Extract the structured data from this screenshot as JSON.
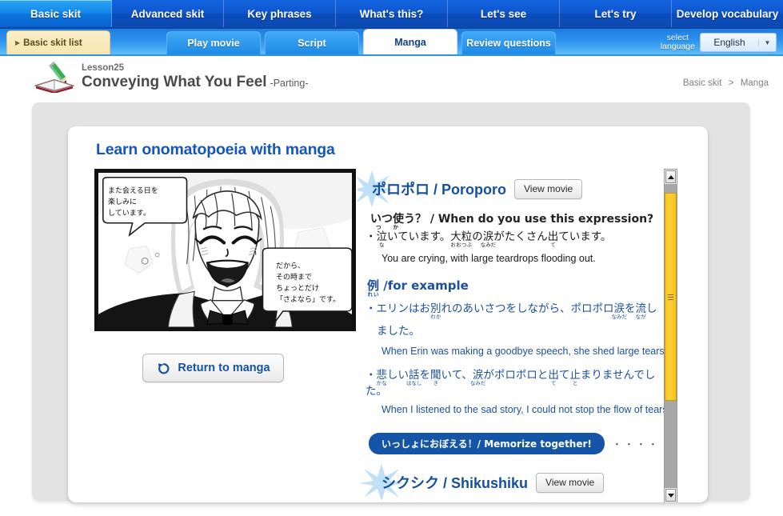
{
  "main_nav": {
    "items": [
      {
        "label": "Basic skit",
        "active": true
      },
      {
        "label": "Advanced skit",
        "active": false
      },
      {
        "label": "Key phrases",
        "active": false
      },
      {
        "label": "What's this?",
        "active": false
      },
      {
        "label": "Let's see",
        "active": false
      },
      {
        "label": "Let's try",
        "active": false
      },
      {
        "label": "Develop vocabulary",
        "active": false
      }
    ]
  },
  "sub_nav": {
    "skit_list_label": "Basic skit list",
    "tabs": [
      {
        "label": "Play movie",
        "active": false
      },
      {
        "label": "Script",
        "active": false
      },
      {
        "label": "Manga",
        "active": true
      },
      {
        "label": "Review questions",
        "active": false
      }
    ],
    "language_label_line1": "select",
    "language_label_line2": "language",
    "language_value": "English"
  },
  "lesson": {
    "number": "Lesson25",
    "title": "Conveying What You Feel",
    "subtitle": "-Parting-"
  },
  "breadcrumb": {
    "parent": "Basic skit",
    "separator": ">",
    "current": "Manga"
  },
  "panel": {
    "title": "Learn onomatopoeia with manga"
  },
  "manga": {
    "bubble_left": "また会える日を\n楽しみに\nしています。",
    "bubble_right": "だから、\nその時まで\nちょっとだけ\n「さよなら」です。",
    "return_button_label": "Return to manga",
    "return_icon": "undo-arrow-icon"
  },
  "entries": [
    {
      "title_jp": "ポロポロ",
      "title_sep": " / ",
      "title_romaji": "Poroporo",
      "view_movie_label": "View movie",
      "question_line": "いつ使う？ / When do you use this expression?",
      "question_ruby": "つか",
      "usage_jp_prefix": "・",
      "usage_jp": "泣いています。大粒の涙がたくさん出ています。",
      "usage_ruby": [
        "な",
        "おおつぶ",
        "なみだ",
        "て"
      ],
      "usage_en": "You are crying, with large teardrops flooding out.",
      "example_label": "例 /for example",
      "example_label_ruby": "れい",
      "examples": [
        {
          "jp": "・エリンはお別れのあいさつをしながら、ポロポロ涙を流しました。",
          "ruby": [
            "わか",
            "なみだ",
            "なが"
          ],
          "en": "When Erin was making a goodbye speech, she shed large tears."
        },
        {
          "jp": "・悲しい話を聞いて、涙がポロポロと出て止まりませんでした。",
          "ruby": [
            "かな",
            "はなし",
            "き",
            "なみだ",
            "て",
            "と"
          ],
          "en": "When I listened to the sad story, I could not stop the flow of tears."
        }
      ],
      "memorize_label": "いっしょにおぼえる！/ Memorize together!",
      "memorize_dots": "・・・・・・・・・・・・・・"
    },
    {
      "title_jp": "シクシク",
      "title_sep": " / ",
      "title_romaji": "Shikushiku",
      "view_movie_label": "View movie"
    }
  ],
  "scrollbar": {
    "up_icon": "chevron-up-icon",
    "down_icon": "chevron-down-icon",
    "thumb_color": "#f5c518"
  },
  "colors": {
    "nav_blue": "#0b55c4",
    "tab_blue": "#3fa9f5",
    "title_blue": "#1356bd",
    "entry_blue": "#15509d",
    "pill_blue": "#1455a8",
    "skit_list_cream": "#f6e5b0"
  }
}
